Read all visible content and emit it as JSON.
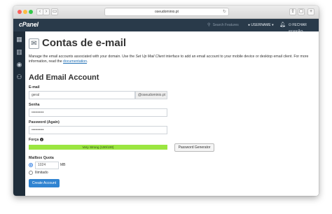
{
  "browser": {
    "url": "oseudominio.pt"
  },
  "header": {
    "logo": "cPanel",
    "search_placeholder": "Search Features",
    "username": "USERNAME",
    "logout": "FECHAR SESSÃO"
  },
  "page": {
    "title": "Contas de e-mail",
    "description_1": "Manage the email accounts associated with your domain. Use the ",
    "description_em": "Set Up Mail Client",
    "description_2": " interface to add an email account to your mobile device or desktop email client. For more information, read the ",
    "description_link": "documentation",
    "description_end": ".",
    "section_title": "Add Email Account"
  },
  "form": {
    "email_label": "E-mail",
    "email_value": "geral",
    "email_domain": "@oseudominio.pt",
    "password_label": "Senha",
    "password_value": "••••••••••",
    "password_again_label": "Password (Again)",
    "password_again_value": "••••••••••",
    "strength_label": "Força",
    "strength_text": "Very Strong (100/100)",
    "strength_percent": 100,
    "generator_button": "Password Generator",
    "quota_label": "Mailbox Quota",
    "quota_value": "1024",
    "quota_unit": "MB",
    "quota_unlimited": "Ilimitado",
    "quota_selected": "limited",
    "create_button": "Create Account"
  },
  "colors": {
    "header_bg": "#293a4a",
    "sidebar_bg": "#1f2d3a",
    "strength_bar": "#9be640",
    "primary_button": "#2f83d1"
  }
}
